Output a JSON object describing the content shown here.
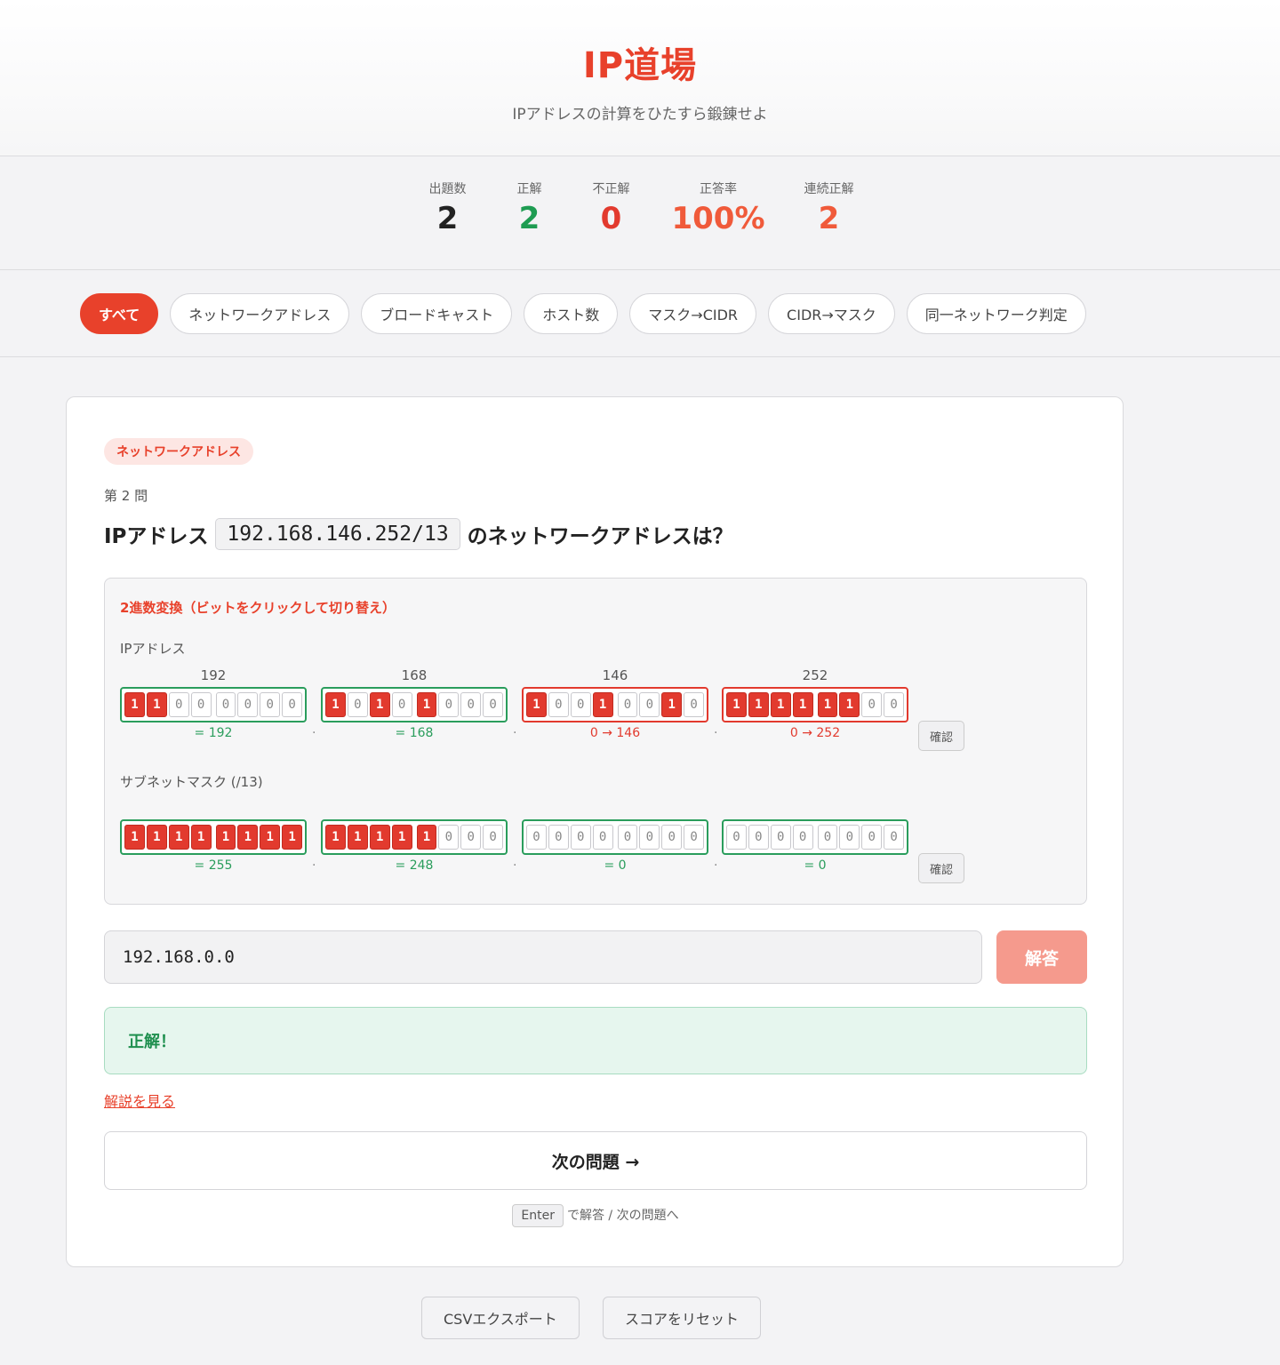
{
  "header": {
    "title": "IP道場",
    "subtitle": "IPアドレスの計算をひたすら鍛錬せよ"
  },
  "stats": [
    {
      "label": "出題数",
      "value": "2",
      "color": "#222222"
    },
    {
      "label": "正解",
      "value": "2",
      "color": "#1e9c52"
    },
    {
      "label": "不正解",
      "value": "0",
      "color": "#e23a2e"
    },
    {
      "label": "正答率",
      "value": "100%",
      "color": "#f05a3a"
    },
    {
      "label": "連続正解",
      "value": "2",
      "color": "#f05a3a"
    }
  ],
  "tabs": [
    {
      "label": "すべて",
      "active": true
    },
    {
      "label": "ネットワークアドレス",
      "active": false
    },
    {
      "label": "ブロードキャスト",
      "active": false
    },
    {
      "label": "ホスト数",
      "active": false
    },
    {
      "label": "マスク→CIDR",
      "active": false
    },
    {
      "label": "CIDR→マスク",
      "active": false
    },
    {
      "label": "同一ネットワーク判定",
      "active": false
    }
  ],
  "question": {
    "category": "ネットワークアドレス",
    "number_label": "第 2 問",
    "prefix": "IPアドレス",
    "ip": "192.168.146.252/13",
    "suffix": "のネットワークアドレスは？"
  },
  "binary": {
    "title": "2進数変換（ビットをクリックして切り替え）",
    "ip_label": "IPアドレス",
    "mask_label": "サブネットマスク (/13)",
    "check_label": "確認",
    "ip_octets": [
      {
        "value": "192",
        "bits": [
          1,
          1,
          0,
          0,
          0,
          0,
          0,
          0
        ],
        "result": "= 192",
        "correct": true
      },
      {
        "value": "168",
        "bits": [
          1,
          0,
          1,
          0,
          1,
          0,
          0,
          0
        ],
        "result": "= 168",
        "correct": true
      },
      {
        "value": "146",
        "bits": [
          1,
          0,
          0,
          1,
          0,
          0,
          1,
          0
        ],
        "result": "0 → 146",
        "correct": false
      },
      {
        "value": "252",
        "bits": [
          1,
          1,
          1,
          1,
          1,
          1,
          0,
          0
        ],
        "result": "0 → 252",
        "correct": false
      }
    ],
    "mask_octets": [
      {
        "bits": [
          1,
          1,
          1,
          1,
          1,
          1,
          1,
          1
        ],
        "result": "= 255",
        "correct": true
      },
      {
        "bits": [
          1,
          1,
          1,
          1,
          1,
          0,
          0,
          0
        ],
        "result": "= 248",
        "correct": true
      },
      {
        "bits": [
          0,
          0,
          0,
          0,
          0,
          0,
          0,
          0
        ],
        "result": "= 0",
        "correct": true
      },
      {
        "bits": [
          0,
          0,
          0,
          0,
          0,
          0,
          0,
          0
        ],
        "result": "= 0",
        "correct": true
      }
    ],
    "separator": "."
  },
  "answer": {
    "value": "192.168.0.0",
    "submit_label": "解答"
  },
  "feedback": {
    "text": "正解！"
  },
  "explain_label": "解説を見る",
  "next_label": "次の問題 →",
  "hint": {
    "key": "Enter",
    "text": "で解答 / 次の問題へ"
  },
  "footer": {
    "export_label": "CSVエクスポート",
    "reset_label": "スコアをリセット"
  }
}
